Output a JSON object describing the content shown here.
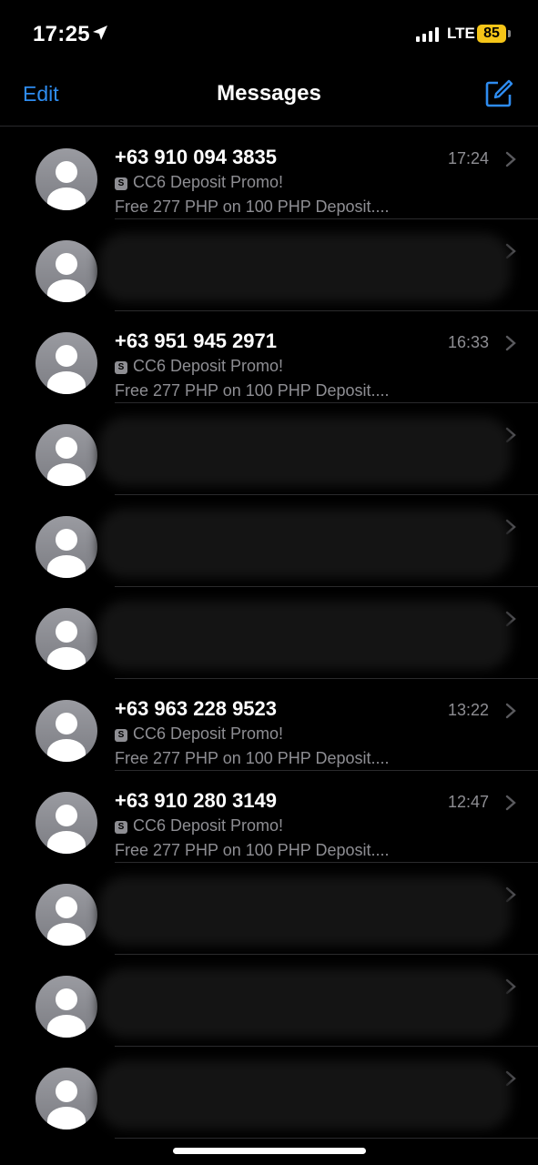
{
  "status": {
    "time": "17:25",
    "network": "LTE",
    "battery": "85"
  },
  "nav": {
    "edit": "Edit",
    "title": "Messages"
  },
  "messages": [
    {
      "sender": "+63 910 094 3835",
      "time": "17:24",
      "subject": "CC6 Deposit Promo!",
      "preview": "Free 277 PHP on 100 PHP Deposit....",
      "redacted": false
    },
    {
      "sender": "",
      "time": "",
      "subject": "",
      "preview": "",
      "redacted": true
    },
    {
      "sender": "+63 951 945 2971",
      "time": "16:33",
      "subject": "CC6 Deposit Promo!",
      "preview": "Free 277 PHP on 100 PHP Deposit....",
      "redacted": false
    },
    {
      "sender": "",
      "time": "",
      "subject": "",
      "preview": "",
      "redacted": true
    },
    {
      "sender": "",
      "time": "",
      "subject": "",
      "preview": "",
      "redacted": true
    },
    {
      "sender": "",
      "time": "",
      "subject": "",
      "preview": "",
      "redacted": true
    },
    {
      "sender": "+63 963 228 9523",
      "time": "13:22",
      "subject": "CC6 Deposit Promo!",
      "preview": "Free 277 PHP on 100 PHP Deposit....",
      "redacted": false
    },
    {
      "sender": "+63 910 280 3149",
      "time": "12:47",
      "subject": "CC6 Deposit Promo!",
      "preview": "Free 277 PHP on 100 PHP Deposit....",
      "redacted": false
    },
    {
      "sender": "",
      "time": "",
      "subject": "",
      "preview": "",
      "redacted": true
    },
    {
      "sender": "",
      "time": "",
      "subject": "",
      "preview": "",
      "redacted": true
    },
    {
      "sender": "",
      "time": "",
      "subject": "",
      "preview": "",
      "redacted": true
    }
  ],
  "colors": {
    "accent": "#2e8cf0",
    "battery": "#f5c518",
    "secondary_text": "#8e8e93"
  },
  "icons": {
    "location": "location-arrow-icon",
    "signal": "signal-bars-icon",
    "compose": "compose-icon",
    "chevron": "chevron-right-icon",
    "avatar": "person-silhouette-icon",
    "sms_badge": "s-badge-icon"
  }
}
